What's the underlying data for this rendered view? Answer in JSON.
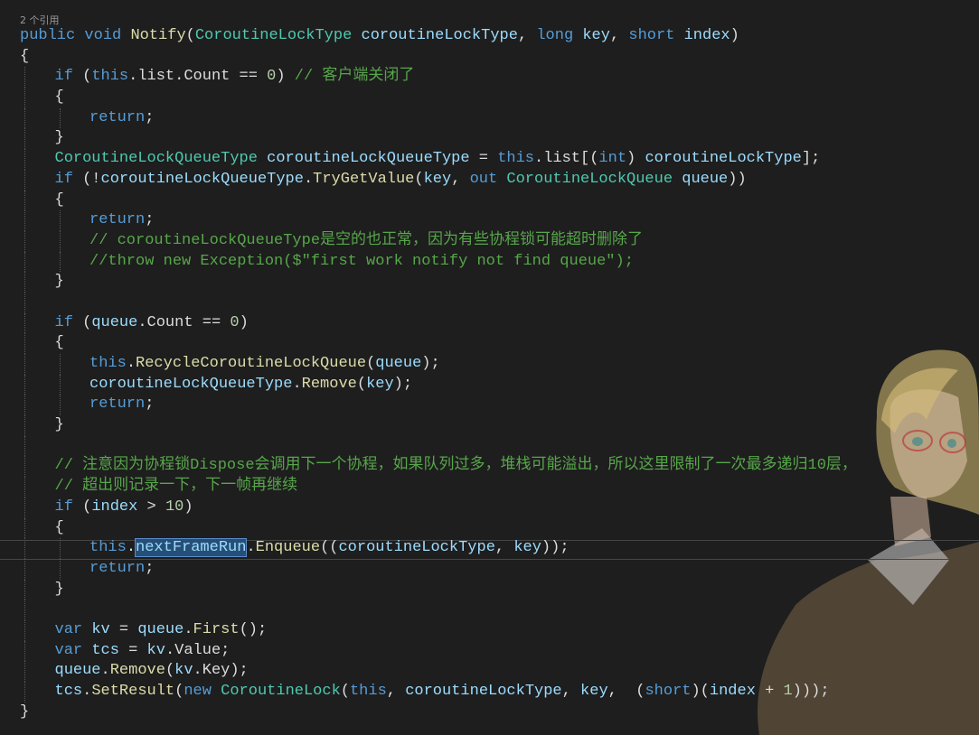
{
  "editor": {
    "codelens": "2 个引用",
    "colors": {
      "background": "#1e1e1e",
      "keyword": "#569cd6",
      "type": "#4ec9b0",
      "method": "#dcdcaa",
      "variable": "#9cdcfe",
      "comment": "#57a64a",
      "number": "#b5cea8",
      "plain": "#dcdcdc"
    },
    "lines": [
      {
        "indent": 0,
        "tokens": [
          {
            "t": "public",
            "k": "keyword"
          },
          {
            "t": " ",
            "k": "plain"
          },
          {
            "t": "void",
            "k": "keyword"
          },
          {
            "t": " ",
            "k": "plain"
          },
          {
            "t": "Notify",
            "k": "method"
          },
          {
            "t": "(",
            "k": "plain"
          },
          {
            "t": "CoroutineLockType",
            "k": "type"
          },
          {
            "t": " ",
            "k": "plain"
          },
          {
            "t": "coroutineLockType",
            "k": "variable"
          },
          {
            "t": ", ",
            "k": "plain"
          },
          {
            "t": "long",
            "k": "keyword"
          },
          {
            "t": " ",
            "k": "plain"
          },
          {
            "t": "key",
            "k": "variable"
          },
          {
            "t": ", ",
            "k": "plain"
          },
          {
            "t": "short",
            "k": "keyword"
          },
          {
            "t": " ",
            "k": "plain"
          },
          {
            "t": "index",
            "k": "variable"
          },
          {
            "t": ")",
            "k": "plain"
          }
        ]
      },
      {
        "indent": 0,
        "tokens": [
          {
            "t": "{",
            "k": "plain"
          }
        ]
      },
      {
        "indent": 1,
        "tokens": [
          {
            "t": "if",
            "k": "keyword"
          },
          {
            "t": " (",
            "k": "plain"
          },
          {
            "t": "this",
            "k": "keyword"
          },
          {
            "t": ".list.Count == ",
            "k": "plain"
          },
          {
            "t": "0",
            "k": "number"
          },
          {
            "t": ") ",
            "k": "plain"
          },
          {
            "t": "// 客户端关闭了",
            "k": "comment"
          }
        ]
      },
      {
        "indent": 1,
        "tokens": [
          {
            "t": "{",
            "k": "plain"
          }
        ]
      },
      {
        "indent": 2,
        "tokens": [
          {
            "t": "return",
            "k": "keyword"
          },
          {
            "t": ";",
            "k": "plain"
          }
        ]
      },
      {
        "indent": 1,
        "tokens": [
          {
            "t": "}",
            "k": "plain"
          }
        ]
      },
      {
        "indent": 1,
        "tokens": [
          {
            "t": "CoroutineLockQueueType",
            "k": "type"
          },
          {
            "t": " ",
            "k": "plain"
          },
          {
            "t": "coroutineLockQueueType",
            "k": "variable"
          },
          {
            "t": " = ",
            "k": "plain"
          },
          {
            "t": "this",
            "k": "keyword"
          },
          {
            "t": ".list[(",
            "k": "plain"
          },
          {
            "t": "int",
            "k": "keyword"
          },
          {
            "t": ") ",
            "k": "plain"
          },
          {
            "t": "coroutineLockType",
            "k": "variable"
          },
          {
            "t": "];",
            "k": "plain"
          }
        ]
      },
      {
        "indent": 1,
        "tokens": [
          {
            "t": "if",
            "k": "keyword"
          },
          {
            "t": " (!",
            "k": "plain"
          },
          {
            "t": "coroutineLockQueueType",
            "k": "variable"
          },
          {
            "t": ".",
            "k": "plain"
          },
          {
            "t": "TryGetValue",
            "k": "method"
          },
          {
            "t": "(",
            "k": "plain"
          },
          {
            "t": "key",
            "k": "variable"
          },
          {
            "t": ", ",
            "k": "plain"
          },
          {
            "t": "out",
            "k": "keyword"
          },
          {
            "t": " ",
            "k": "plain"
          },
          {
            "t": "CoroutineLockQueue",
            "k": "type"
          },
          {
            "t": " ",
            "k": "plain"
          },
          {
            "t": "queue",
            "k": "variable"
          },
          {
            "t": "))",
            "k": "plain"
          }
        ]
      },
      {
        "indent": 1,
        "tokens": [
          {
            "t": "{",
            "k": "plain"
          }
        ]
      },
      {
        "indent": 2,
        "tokens": [
          {
            "t": "return",
            "k": "keyword"
          },
          {
            "t": ";",
            "k": "plain"
          }
        ]
      },
      {
        "indent": 2,
        "tokens": [
          {
            "t": "// coroutineLockQueueType是空的也正常，因为有些协程锁可能超时删除了",
            "k": "comment"
          }
        ]
      },
      {
        "indent": 2,
        "tokens": [
          {
            "t": "//throw new Exception($\"first work notify not find queue\");",
            "k": "comment"
          }
        ]
      },
      {
        "indent": 1,
        "tokens": [
          {
            "t": "}",
            "k": "plain"
          }
        ]
      },
      {
        "indent": 1,
        "tokens": []
      },
      {
        "indent": 1,
        "tokens": [
          {
            "t": "if",
            "k": "keyword"
          },
          {
            "t": " (",
            "k": "plain"
          },
          {
            "t": "queue",
            "k": "variable"
          },
          {
            "t": ".Count == ",
            "k": "plain"
          },
          {
            "t": "0",
            "k": "number"
          },
          {
            "t": ")",
            "k": "plain"
          }
        ]
      },
      {
        "indent": 1,
        "tokens": [
          {
            "t": "{",
            "k": "plain"
          }
        ]
      },
      {
        "indent": 2,
        "tokens": [
          {
            "t": "this",
            "k": "keyword"
          },
          {
            "t": ".",
            "k": "plain"
          },
          {
            "t": "RecycleCoroutineLockQueue",
            "k": "method"
          },
          {
            "t": "(",
            "k": "plain"
          },
          {
            "t": "queue",
            "k": "variable"
          },
          {
            "t": ");",
            "k": "plain"
          }
        ]
      },
      {
        "indent": 2,
        "tokens": [
          {
            "t": "coroutineLockQueueType",
            "k": "variable"
          },
          {
            "t": ".",
            "k": "plain"
          },
          {
            "t": "Remove",
            "k": "method"
          },
          {
            "t": "(",
            "k": "plain"
          },
          {
            "t": "key",
            "k": "variable"
          },
          {
            "t": ");",
            "k": "plain"
          }
        ]
      },
      {
        "indent": 2,
        "tokens": [
          {
            "t": "return",
            "k": "keyword"
          },
          {
            "t": ";",
            "k": "plain"
          }
        ]
      },
      {
        "indent": 1,
        "tokens": [
          {
            "t": "}",
            "k": "plain"
          }
        ]
      },
      {
        "indent": 1,
        "tokens": []
      },
      {
        "indent": 1,
        "tokens": [
          {
            "t": "// 注意因为协程锁Dispose会调用下一个协程，如果队列过多，堆栈可能溢出，所以这里限制了一次最多递归10层，",
            "k": "comment"
          }
        ]
      },
      {
        "indent": 1,
        "tokens": [
          {
            "t": "// 超出则记录一下，下一帧再继续",
            "k": "comment"
          }
        ]
      },
      {
        "indent": 1,
        "tokens": [
          {
            "t": "if",
            "k": "keyword"
          },
          {
            "t": " (",
            "k": "plain"
          },
          {
            "t": "index",
            "k": "variable"
          },
          {
            "t": " > ",
            "k": "plain"
          },
          {
            "t": "10",
            "k": "number"
          },
          {
            "t": ")",
            "k": "plain"
          }
        ]
      },
      {
        "indent": 1,
        "tokens": [
          {
            "t": "{",
            "k": "plain"
          }
        ]
      },
      {
        "indent": 2,
        "tokens": [
          {
            "t": "this",
            "k": "keyword"
          },
          {
            "t": ".",
            "k": "plain"
          },
          {
            "t": "nextFrameRun",
            "k": "variable",
            "hl": true
          },
          {
            "t": ".",
            "k": "plain"
          },
          {
            "t": "Enqueue",
            "k": "method"
          },
          {
            "t": "((",
            "k": "plain"
          },
          {
            "t": "coroutineLockType",
            "k": "variable"
          },
          {
            "t": ", ",
            "k": "plain"
          },
          {
            "t": "key",
            "k": "variable"
          },
          {
            "t": "));",
            "k": "plain"
          }
        ]
      },
      {
        "indent": 2,
        "tokens": [
          {
            "t": "return",
            "k": "keyword"
          },
          {
            "t": ";",
            "k": "plain"
          }
        ]
      },
      {
        "indent": 1,
        "tokens": [
          {
            "t": "}",
            "k": "plain"
          }
        ]
      },
      {
        "indent": 1,
        "tokens": []
      },
      {
        "indent": 1,
        "tokens": [
          {
            "t": "var",
            "k": "keyword"
          },
          {
            "t": " ",
            "k": "plain"
          },
          {
            "t": "kv",
            "k": "variable"
          },
          {
            "t": " = ",
            "k": "plain"
          },
          {
            "t": "queue",
            "k": "variable"
          },
          {
            "t": ".",
            "k": "plain"
          },
          {
            "t": "First",
            "k": "method"
          },
          {
            "t": "();",
            "k": "plain"
          }
        ]
      },
      {
        "indent": 1,
        "tokens": [
          {
            "t": "var",
            "k": "keyword"
          },
          {
            "t": " ",
            "k": "plain"
          },
          {
            "t": "tcs",
            "k": "variable"
          },
          {
            "t": " = ",
            "k": "plain"
          },
          {
            "t": "kv",
            "k": "variable"
          },
          {
            "t": ".Value;",
            "k": "plain"
          }
        ]
      },
      {
        "indent": 1,
        "tokens": [
          {
            "t": "queue",
            "k": "variable"
          },
          {
            "t": ".",
            "k": "plain"
          },
          {
            "t": "Remove",
            "k": "method"
          },
          {
            "t": "(",
            "k": "plain"
          },
          {
            "t": "kv",
            "k": "variable"
          },
          {
            "t": ".Key);",
            "k": "plain"
          }
        ]
      },
      {
        "indent": 1,
        "tokens": [
          {
            "t": "tcs",
            "k": "variable"
          },
          {
            "t": ".",
            "k": "plain"
          },
          {
            "t": "SetResult",
            "k": "method"
          },
          {
            "t": "(",
            "k": "plain"
          },
          {
            "t": "new",
            "k": "keyword"
          },
          {
            "t": " ",
            "k": "plain"
          },
          {
            "t": "CoroutineLock",
            "k": "type"
          },
          {
            "t": "(",
            "k": "plain"
          },
          {
            "t": "this",
            "k": "keyword"
          },
          {
            "t": ", ",
            "k": "plain"
          },
          {
            "t": "coroutineLockType",
            "k": "variable"
          },
          {
            "t": ", ",
            "k": "plain"
          },
          {
            "t": "key",
            "k": "variable"
          },
          {
            "t": ",  (",
            "k": "plain"
          },
          {
            "t": "short",
            "k": "keyword"
          },
          {
            "t": ")(",
            "k": "plain"
          },
          {
            "t": "index",
            "k": "variable"
          },
          {
            "t": " + ",
            "k": "plain"
          },
          {
            "t": "1",
            "k": "number"
          },
          {
            "t": ")));",
            "k": "plain"
          }
        ]
      },
      {
        "indent": 0,
        "tokens": [
          {
            "t": "}",
            "k": "plain"
          }
        ]
      }
    ]
  }
}
